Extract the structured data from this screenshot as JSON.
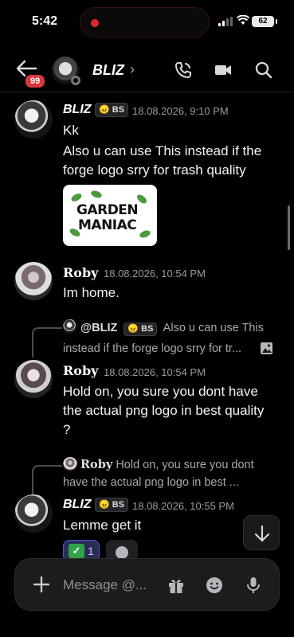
{
  "status_bar": {
    "time": "5:42",
    "battery": "62"
  },
  "header": {
    "channel_name": "BLIZ",
    "unread_badge": "99",
    "chevron": "›"
  },
  "messages": [
    {
      "author": "BLIZ",
      "tag": "BS",
      "timestamp": "18.08.2026, 9:10 PM",
      "lines": [
        "Kk",
        "Also u can use This instead if the forge logo srry for trash quality"
      ],
      "attachment": {
        "line1": "GARDEN",
        "line2": "MANIAC"
      }
    },
    {
      "author": "Roby",
      "timestamp": "18.08.2026, 10:54 PM",
      "lines": [
        "Im home."
      ]
    },
    {
      "reply_to": {
        "author": "@BLIZ",
        "tag": "BS",
        "preview_1": "Also u can use This",
        "preview_2": "instead if the forge logo srry for tr..."
      },
      "author": "Roby",
      "timestamp": "18.08.2026, 10:54 PM",
      "lines": [
        "Hold on, you sure you dont have the actual png logo in best quality ?"
      ]
    },
    {
      "reply_to": {
        "author": "Roby",
        "preview_1": "Hold on, you sure you dont",
        "preview_2": "have the actual png logo in best ..."
      },
      "author": "BLIZ",
      "tag": "BS",
      "timestamp": "18.08.2026, 10:55 PM",
      "lines": [
        "Lemme get it"
      ],
      "reactions": [
        {
          "emoji": "check-mark",
          "count": "1"
        }
      ]
    }
  ],
  "composer": {
    "placeholder": "Message @..."
  },
  "colors": {
    "badge": "#da373c",
    "reaction_bg": "#2a2e55",
    "reaction_border": "#4c5ad8",
    "check_emoji": "#2fa24a",
    "background": "#000000"
  }
}
